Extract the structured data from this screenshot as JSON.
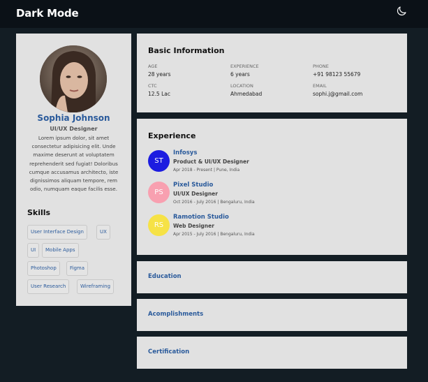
{
  "header": {
    "title": "Dark Mode",
    "theme_icon": "moon-icon"
  },
  "profile": {
    "name": "Sophia Johnson",
    "role": "UI/UX Designer",
    "bio": "Lorem ipsum dolor, sit amet consectetur adipisicing elit. Unde maxime deserunt at voluptatem reprehenderit sed fugiat! Doloribus cumque accusamus architecto, iste dignissimos aliquam tempore, rem odio, numquam eaque facilis esse.",
    "skills_title": "Skills",
    "skills": [
      "User Interface Design",
      "UX",
      "UI",
      "Mobile Apps",
      "Photoshop",
      "Figma",
      "User Research",
      "Wireframing"
    ]
  },
  "basic": {
    "title": "Basic Information",
    "fields": [
      {
        "label": "AGE",
        "value": "28 years"
      },
      {
        "label": "EXPERIENCE",
        "value": "6 years"
      },
      {
        "label": "PHONE",
        "value": "+91 98123 55679"
      },
      {
        "label": "CTC",
        "value": "12.5 Lac"
      },
      {
        "label": "LOCATION",
        "value": "Ahmedabad"
      },
      {
        "label": "EMAIL",
        "value": "sophi.j@gmail.com"
      }
    ]
  },
  "experience": {
    "title": "Experience",
    "items": [
      {
        "initials": "ST",
        "color": "#1c1ce0",
        "company": "Infosys",
        "position": "Product & UI/UX Designer",
        "dates": "Apr 2018 - Present | Pune, India"
      },
      {
        "initials": "PS",
        "color": "#f8a0b0",
        "company": "Pixel Studio",
        "position": "UI/UX Designer",
        "dates": "Oct 2016 - July 2016 | Bengaluru, India"
      },
      {
        "initials": "RS",
        "color": "#f6e246",
        "company": "Ramotion Studio",
        "position": "Web Designer",
        "dates": "Apr 2015 - July 2016 | Bengaluru, India"
      }
    ]
  },
  "sections": [
    {
      "label": "Education"
    },
    {
      "label": "Acomplishments"
    },
    {
      "label": "Certification"
    }
  ]
}
